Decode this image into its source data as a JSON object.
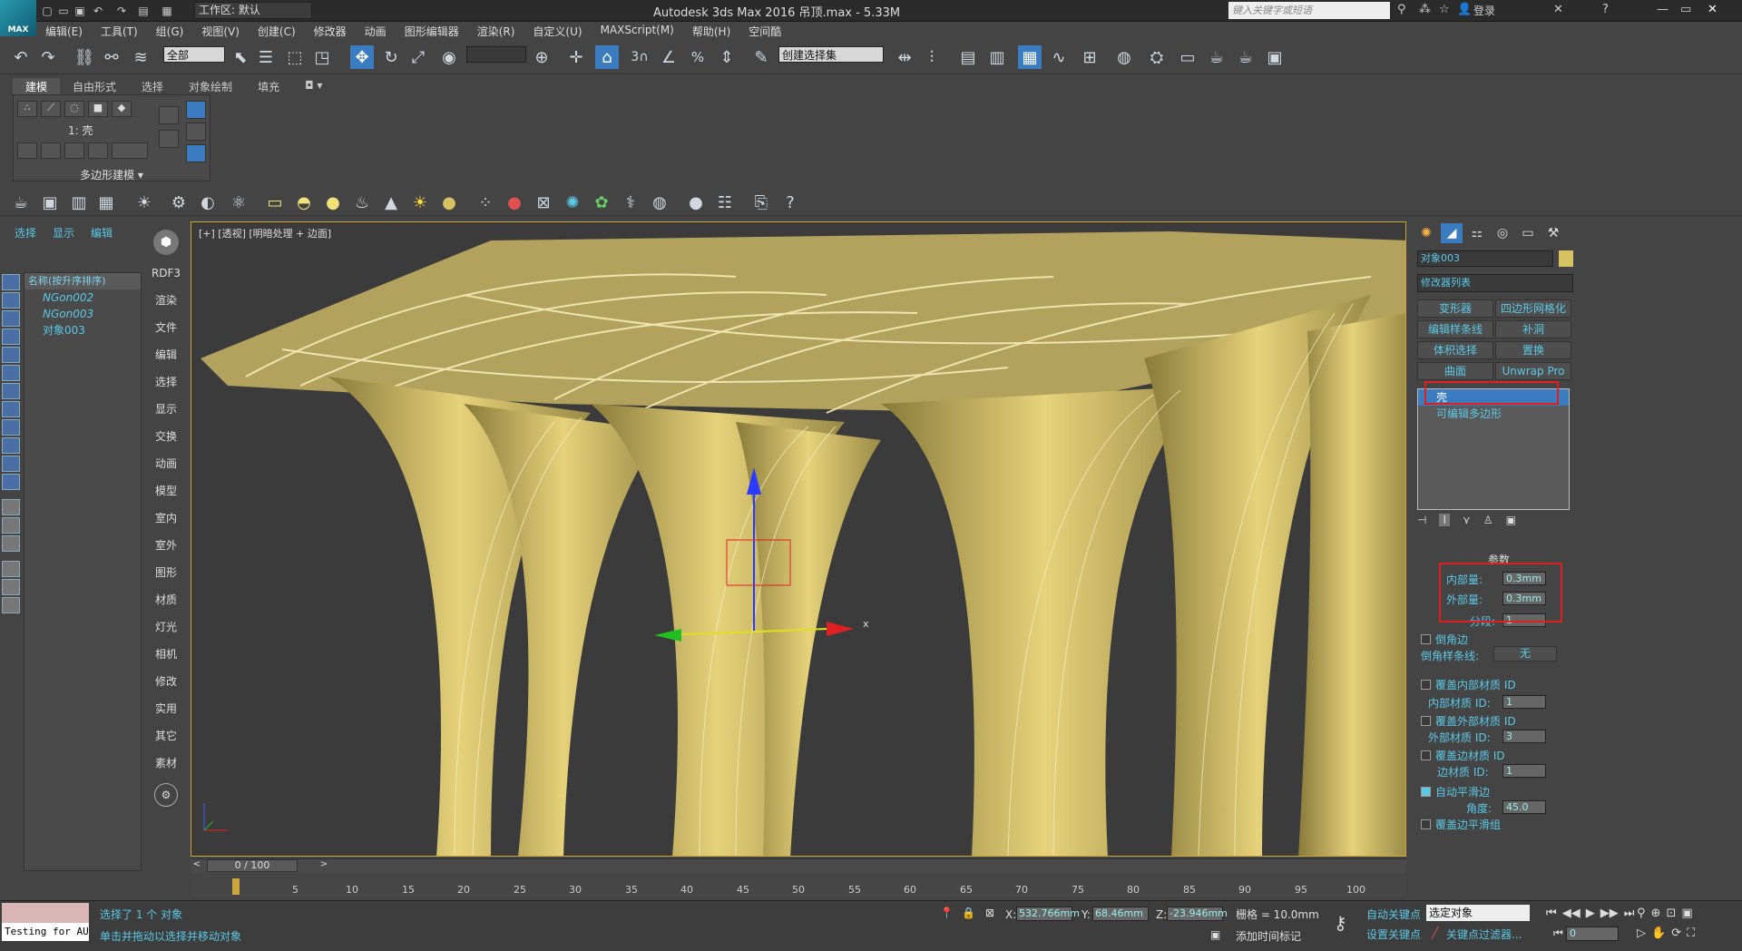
{
  "app": {
    "title": "Autodesk 3ds Max 2016    吊顶.max - 5.33M",
    "logo_text": "MAX",
    "workspace": "工作区: 默认",
    "search_placeholder": "键入关键字或短语",
    "login": "登录"
  },
  "menu": [
    "编辑(E)",
    "工具(T)",
    "组(G)",
    "视图(V)",
    "创建(C)",
    "修改器",
    "动画",
    "图形编辑器",
    "渲染(R)",
    "自定义(U)",
    "MAXScript(M)",
    "帮助(H)",
    "空间酷"
  ],
  "toolbar": {
    "selection_filter": "全部",
    "named_selection": "创建选择集",
    "snap_label": "3"
  },
  "ribbon": {
    "tabs": [
      "建模",
      "自由形式",
      "选择",
      "对象绘制",
      "填充"
    ],
    "active_tab": "建模",
    "sub_label": "1: 壳",
    "footer": "多边形建模 ▾"
  },
  "scene_explorer": {
    "tabs": [
      "选择",
      "显示",
      "编辑"
    ],
    "header": "名称(按升序排序)",
    "items": [
      "NGon002",
      "NGon003",
      "对象003"
    ]
  },
  "command_column": [
    "RDF3",
    "渲染",
    "文件",
    "编辑",
    "选择",
    "显示",
    "交换",
    "动画",
    "模型",
    "室内",
    "室外",
    "图形",
    "材质",
    "灯光",
    "相机",
    "修改",
    "实用",
    "其它",
    "素材"
  ],
  "viewport": {
    "label": "[+] [透视] [明暗处理 + 边面]",
    "axis_x": "x"
  },
  "modify_panel": {
    "object_name": "对象003",
    "modifier_list": "修改器列表",
    "buttons": [
      "变形器",
      "四边形网格化",
      "编辑样条线",
      "补洞",
      "体积选择",
      "置换",
      "曲面",
      "Unwrap Pro"
    ],
    "stack": [
      "壳",
      "可编辑多边形"
    ],
    "params_title": "参数",
    "inner_amount_label": "内部量:",
    "inner_amount": "0.3mm",
    "outer_amount_label": "外部量:",
    "outer_amount": "0.3mm",
    "segments_label": "分段:",
    "segments": "1",
    "bevel_edges": "倒角边",
    "bevel_spline_label": "倒角样条线:",
    "bevel_spline": "无",
    "override_inner_mat": "覆盖内部材质 ID",
    "inner_mat_label": "内部材质 ID:",
    "inner_mat": "1",
    "override_outer_mat": "覆盖外部材质 ID",
    "outer_mat_label": "外部材质 ID:",
    "outer_mat": "3",
    "override_edge_mat": "覆盖边材质 ID",
    "edge_mat_label": "边材质 ID:",
    "edge_mat": "1",
    "auto_smooth": "自动平滑边",
    "angle_label": "角度:",
    "angle": "45.0",
    "override_smooth": "覆盖边平滑组"
  },
  "timeline": {
    "frame": "0 / 100",
    "ticks": [
      "5",
      "10",
      "15",
      "20",
      "25",
      "30",
      "35",
      "40",
      "45",
      "50",
      "55",
      "60",
      "65",
      "70",
      "75",
      "80",
      "85",
      "90",
      "95",
      "100"
    ]
  },
  "status": {
    "selected": "选择了 1 个 对象",
    "hint": "单击并拖动以选择并移动对象",
    "testing": "Testing for AU",
    "x_label": "X:",
    "x": "532.766mm",
    "y_label": "Y:",
    "y": "68.46mm",
    "z_label": "Z:",
    "z": "-23.946mm",
    "grid": "栅格 = 10.0mm",
    "add_time_tag": "添加时间标记",
    "auto_key": "自动关键点",
    "set_key": "设置关键点",
    "key_mode": "选定对象",
    "key_filters": "关键点过滤器...",
    "frame_value": "0"
  },
  "colors": {
    "accent": "#5bc8e6",
    "model": "#d6c262",
    "highlight": "#e02020"
  }
}
